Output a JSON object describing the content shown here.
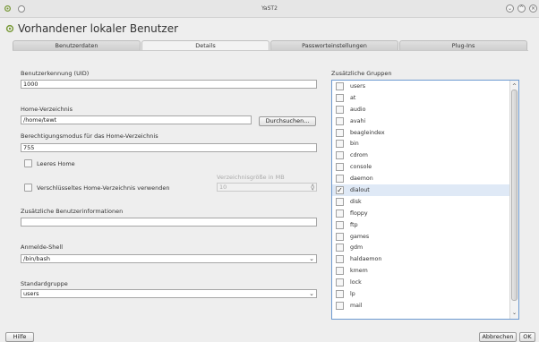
{
  "window": {
    "title": "YaST2"
  },
  "heading": "Vorhandener lokaler Benutzer",
  "tabs": [
    {
      "label": "Benutzerdaten",
      "active": false
    },
    {
      "label": "Details",
      "active": true
    },
    {
      "label": "Passworteinstellungen",
      "active": false
    },
    {
      "label": "Plug-Ins",
      "active": false
    }
  ],
  "details": {
    "uid_label": "Benutzerkennung (UID)",
    "uid_value": "1000",
    "home_label": "Home-Verzeichnis",
    "home_value": "/home/tewt",
    "browse_label": "Durchsuchen...",
    "perm_label": "Berechtigungsmodus für das Home-Verzeichnis",
    "perm_value": "755",
    "empty_home_label": "Leeres Home",
    "dir_size_label": "Verzeichnisgröße in MB",
    "encrypted_label": "Verschlüsseltes Home-Verzeichnis verwenden",
    "dir_size_value": "10",
    "extra_info_label": "Zusätzliche Benutzerinformationen",
    "extra_info_value": "",
    "shell_label": "Anmelde-Shell",
    "shell_value": "/bin/bash",
    "group_label": "Standardgruppe",
    "group_value": "users"
  },
  "groups": {
    "label": "Zusätzliche Gruppen",
    "items": [
      {
        "name": "users",
        "checked": false
      },
      {
        "name": "at",
        "checked": false
      },
      {
        "name": "audio",
        "checked": false
      },
      {
        "name": "avahi",
        "checked": false
      },
      {
        "name": "beagleindex",
        "checked": false
      },
      {
        "name": "bin",
        "checked": false
      },
      {
        "name": "cdrom",
        "checked": false
      },
      {
        "name": "console",
        "checked": false
      },
      {
        "name": "daemon",
        "checked": false
      },
      {
        "name": "dialout",
        "checked": true
      },
      {
        "name": "disk",
        "checked": false
      },
      {
        "name": "floppy",
        "checked": false
      },
      {
        "name": "ftp",
        "checked": false
      },
      {
        "name": "games",
        "checked": false
      },
      {
        "name": "gdm",
        "checked": false
      },
      {
        "name": "haldaemon",
        "checked": false
      },
      {
        "name": "kmem",
        "checked": false
      },
      {
        "name": "lock",
        "checked": false
      },
      {
        "name": "lp",
        "checked": false
      },
      {
        "name": "mail",
        "checked": false
      }
    ]
  },
  "buttons": {
    "help": "Hilfe",
    "cancel": "Abbrechen",
    "ok": "OK"
  },
  "icons": {
    "check_mark": "✓",
    "chevron_down": "⌄",
    "spin": "◊"
  }
}
